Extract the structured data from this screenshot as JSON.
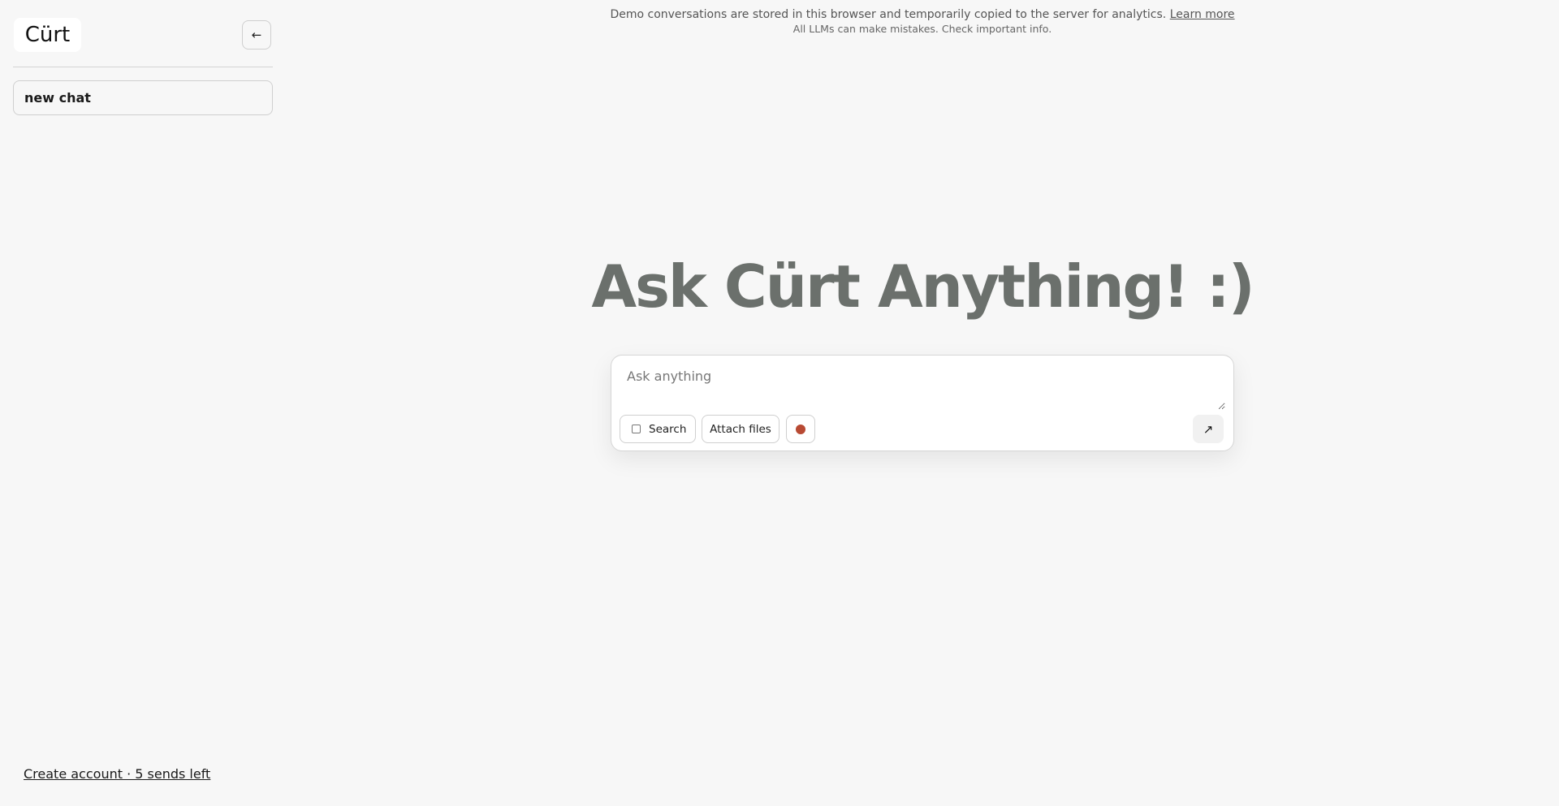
{
  "sidebar": {
    "logo_text": "Cürt",
    "collapse_icon": "←",
    "new_chat_label": "new chat",
    "account_link": "Create account · 5 sends left"
  },
  "notice": {
    "line1": "Demo conversations are stored in this browser and temporarily copied to the server for analytics.",
    "learn_more": "Learn more",
    "line2": "All LLMs can make mistakes. Check important info."
  },
  "hero": {
    "title": "Ask Cürt Anything! :)"
  },
  "composer": {
    "placeholder": "Ask anything",
    "value": "",
    "search_label": "Search",
    "search_checked": false,
    "attach_label": "Attach files",
    "record_icon": "record-dot",
    "send_icon": "↗"
  },
  "colors": {
    "background": "#f7f7f7",
    "title": "#6b706c",
    "record": "#b84a33"
  }
}
